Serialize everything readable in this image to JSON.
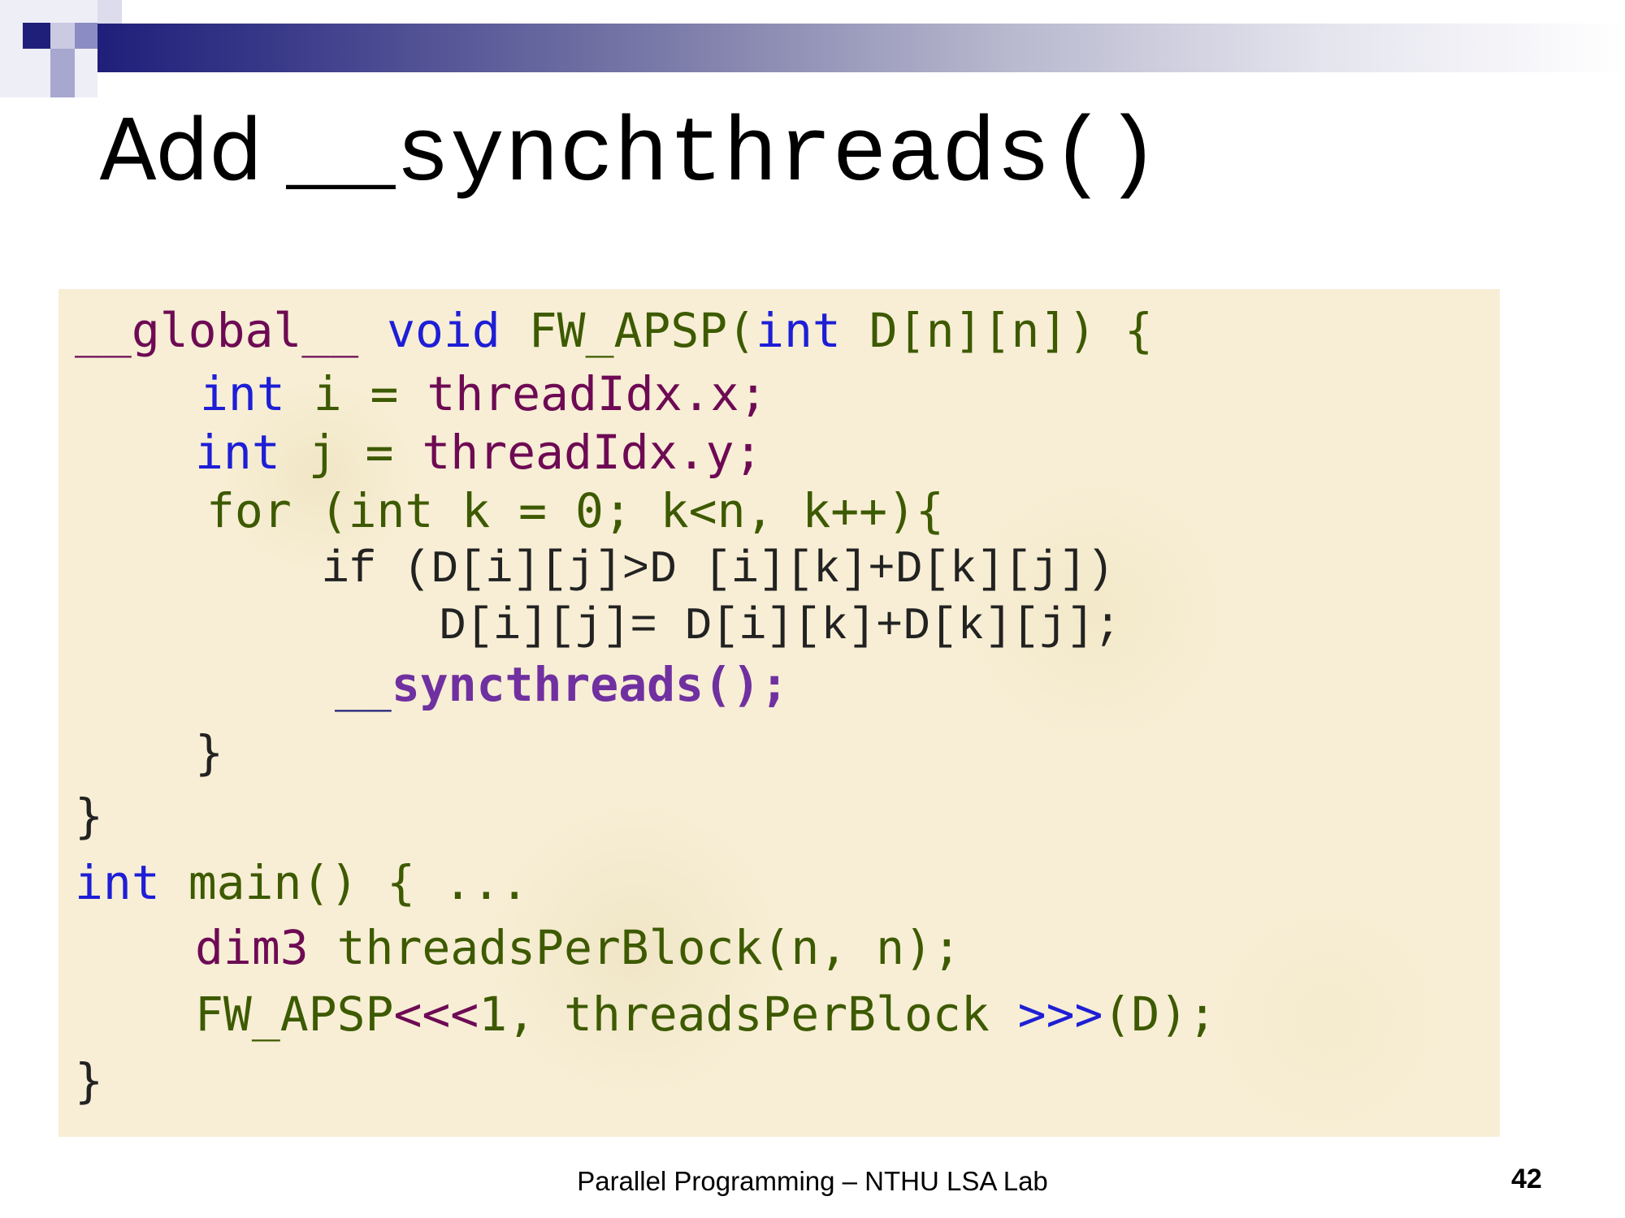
{
  "title": {
    "word": "Add",
    "code": "__synchthreads()"
  },
  "code": {
    "l1": {
      "global": "__global__",
      "void": "void",
      "fn": "FW_APSP(",
      "int": "int",
      "rest": "D[n][n]) {"
    },
    "l2": {
      "int": "int",
      "var": "i = ",
      "thread": "threadIdx.x;"
    },
    "l3": {
      "int": "int",
      "var": "j = ",
      "thread": "threadIdx.y;"
    },
    "l4": {
      "for": "for (",
      "int": "int",
      "rest": "k = 0; k<n, k++){"
    },
    "l5": "if (D[i][j]>D [i][k]+D[k][j])",
    "l6": "D[i][j]= D[i][k]+D[k][j];",
    "l7": {
      "under": "__",
      "sync": "syncthreads();"
    },
    "l8": "}",
    "l9": "}",
    "l10": {
      "int": "int",
      "rest": "main() { ..."
    },
    "l11": {
      "dim": "dim3",
      "rest": "threadsPerBlock(n, n);"
    },
    "l12": {
      "fn": "FW_APSP",
      "open": "<<<",
      "args": "1, threadsPerBlock ",
      "close": ">>>",
      "rest": "(D);"
    },
    "l13": "}"
  },
  "footer": {
    "text": "Parallel Programming – NTHU LSA Lab",
    "page": "42"
  },
  "colors": {
    "keyword_blue": "#1e1ed6",
    "identifier_olive": "#3d5a00",
    "maroon": "#6e0a54",
    "syncthreads_purple": "#7030a0",
    "panel_background": "#f7eed5"
  }
}
